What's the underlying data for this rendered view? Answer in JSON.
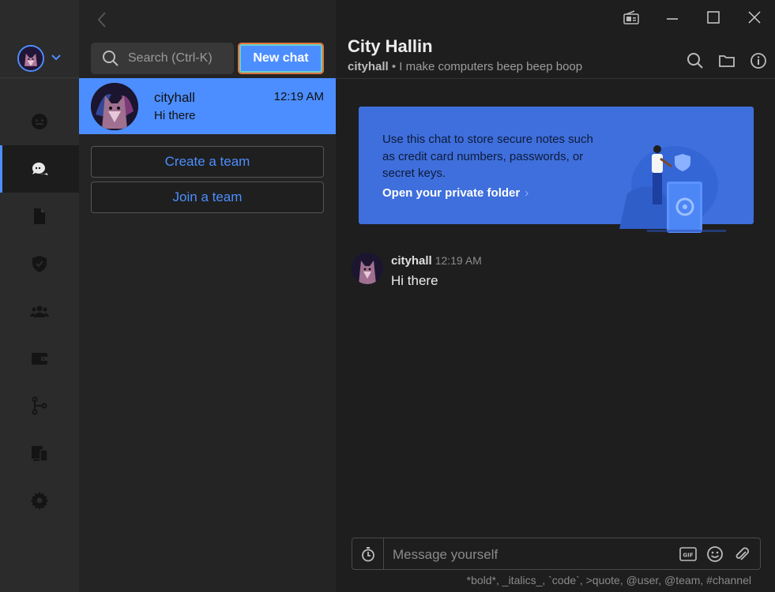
{
  "header": {
    "title": "City Hallin",
    "username": "cityhall",
    "bio": " • I make computers beep beep boop"
  },
  "search": {
    "placeholder": "Search (Ctrl-K)"
  },
  "new_chat_label": "New chat",
  "conversations": [
    {
      "name": "cityhall",
      "time": "12:19 AM",
      "preview": "Hi there"
    }
  ],
  "team_buttons": {
    "create": "Create a team",
    "join": "Join a team"
  },
  "banner": {
    "text": "Use this chat to store secure notes such as credit card numbers, passwords, or secret keys.",
    "link": "Open your private folder",
    "arrow": "›"
  },
  "messages": [
    {
      "author": "cityhall",
      "time": "12:19 AM",
      "text": "Hi there"
    }
  ],
  "composer": {
    "placeholder": "Message yourself",
    "hint": "*bold*, _italics_, `code`, >quote, @user, @team, #channel"
  },
  "nav_icons": [
    "people-icon",
    "chat-icon",
    "files-icon",
    "shield-icon",
    "teams-icon",
    "wallet-icon",
    "git-icon",
    "devices-icon",
    "settings-icon"
  ],
  "colors": {
    "accent": "#4c8eff",
    "banner": "#3f6fdc",
    "background": "#1e1e1e",
    "rail": "#2b2b2b"
  }
}
